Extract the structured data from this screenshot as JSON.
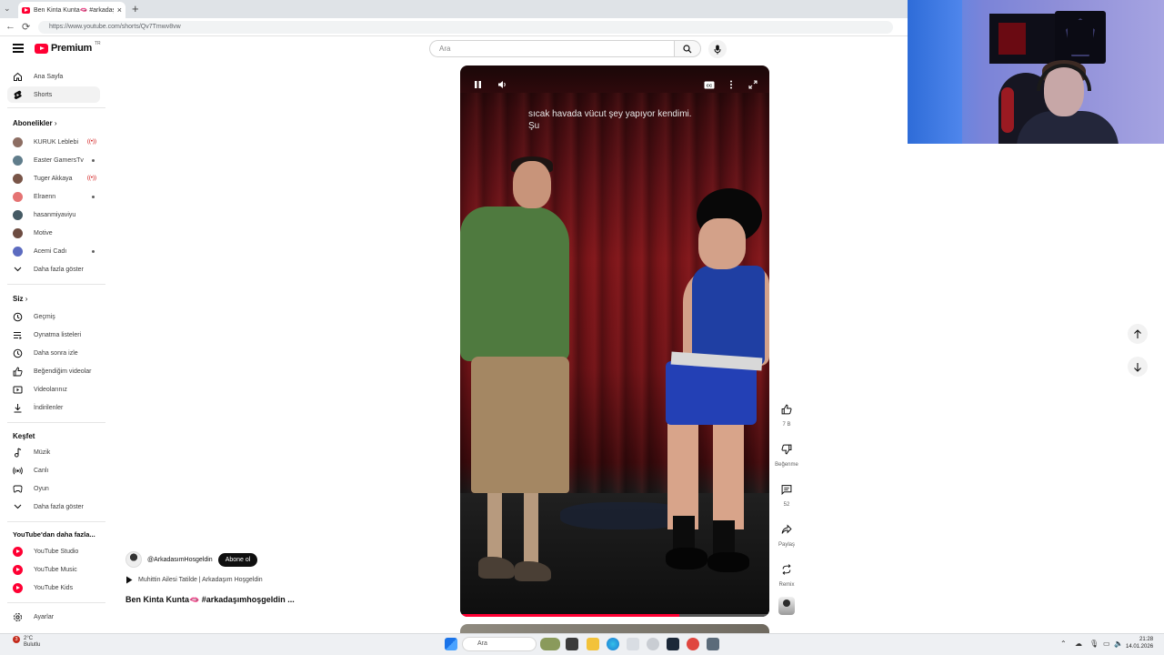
{
  "browser": {
    "tab_title": "Ben Kinta Kunta🫦 #arkadaşı",
    "tab_close": "×",
    "new_tab": "+",
    "url": "https://www.youtube.com/shorts/Qv7Tmwv8vw"
  },
  "masthead": {
    "logo_text": "Premium",
    "logo_sup": "TR",
    "search_placeholder": "Ara"
  },
  "sidebar": {
    "main": [
      {
        "label": "Ana Sayfa",
        "icon": "home-icon"
      },
      {
        "label": "Shorts",
        "icon": "shorts-icon",
        "active": true
      }
    ],
    "subs_header": "Abonelikler",
    "subscriptions": [
      {
        "label": "KURUK Leblebi",
        "status": "live",
        "color": "#8d6e63"
      },
      {
        "label": "Easter GamersTv",
        "status": "dot",
        "color": "#607d8b"
      },
      {
        "label": "Tuger Akkaya",
        "status": "live",
        "color": "#795548"
      },
      {
        "label": "Elraenn",
        "status": "dot",
        "color": "#e57373"
      },
      {
        "label": "hasanmiyaviyu",
        "status": "",
        "color": "#455a64"
      },
      {
        "label": "Motive",
        "status": "",
        "color": "#6d4c41"
      },
      {
        "label": "Acemi Cadı",
        "status": "dot",
        "color": "#5c6bc0"
      }
    ],
    "subs_more": "Daha fazla göster",
    "you_header": "Siz",
    "you_items": [
      {
        "label": "Geçmiş",
        "icon": "history-icon"
      },
      {
        "label": "Oynatma listeleri",
        "icon": "playlists-icon"
      },
      {
        "label": "Daha sonra izle",
        "icon": "watch-later-icon"
      },
      {
        "label": "Beğendiğim videolar",
        "icon": "liked-videos-icon"
      },
      {
        "label": "Videolarınız",
        "icon": "your-videos-icon"
      },
      {
        "label": "İndirilenler",
        "icon": "downloads-icon"
      }
    ],
    "explore_header": "Keşfet",
    "explore_items": [
      {
        "label": "Müzik",
        "icon": "music-icon"
      },
      {
        "label": "Canlı",
        "icon": "live-icon"
      },
      {
        "label": "Oyun",
        "icon": "gaming-icon"
      }
    ],
    "explore_more": "Daha fazla göster",
    "more_header": "YouTube'dan daha fazla...",
    "more_items": [
      {
        "label": "YouTube Studio"
      },
      {
        "label": "YouTube Music"
      },
      {
        "label": "YouTube Kids"
      }
    ],
    "settings": "Ayarlar"
  },
  "video": {
    "caption_line1": "sıcak havada vücut şey yapıyor kendimi.",
    "caption_line2": "Şu",
    "progress": 0.71
  },
  "meta": {
    "handle": "@ArkadasımHosgeldin",
    "subscribe": "Abone ol",
    "music": "Muhittin Ailesi Tatilde | Arkadaşım Hoşgeldin",
    "title": "Ben Kinta Kunta🫦 #arkadaşımhoşgeldin ..."
  },
  "actions": {
    "like_count": "7 B",
    "dislike_label": "Beğenme",
    "comments_count": "52",
    "share_label": "Paylaş",
    "remix_label": "Remix"
  },
  "taskbar": {
    "weather_badge": "3",
    "weather_temp": "2°C",
    "weather_desc": "Bulutlu",
    "search": "Ara",
    "time": "21:28",
    "date": "14.01.2026"
  }
}
